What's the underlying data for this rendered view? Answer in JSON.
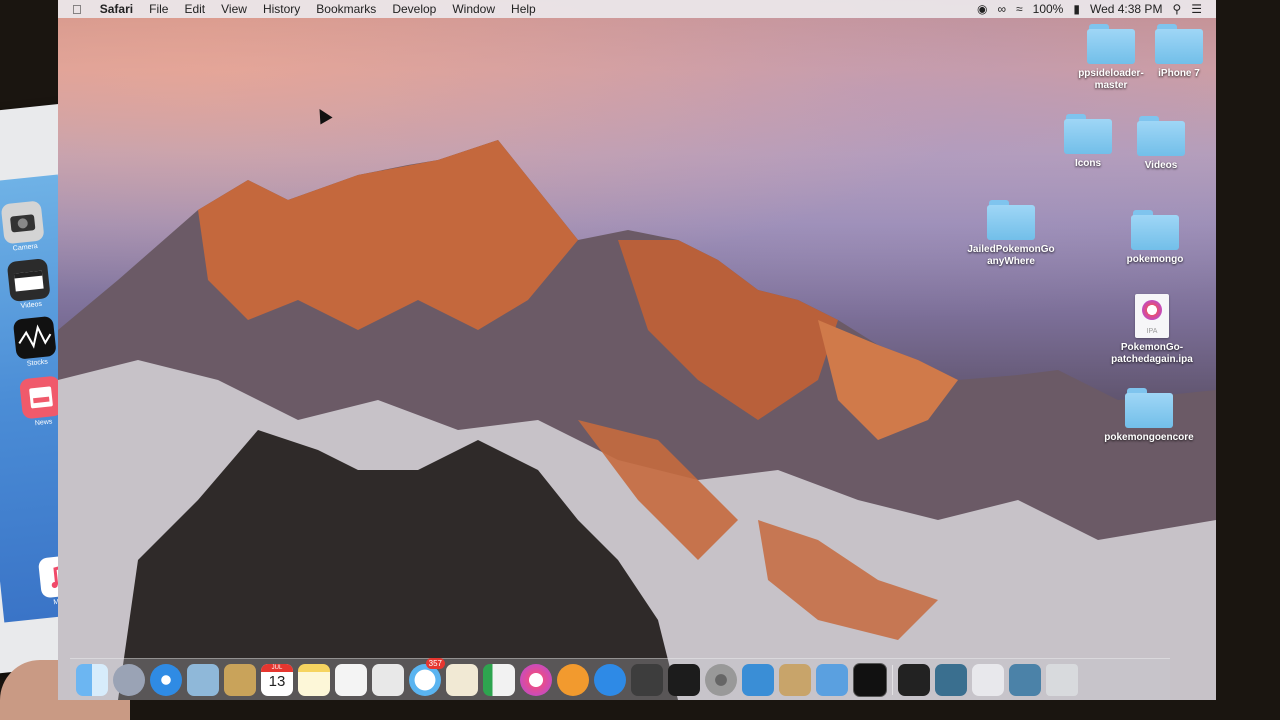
{
  "menubar": {
    "app_name": "Safari",
    "items": [
      "File",
      "Edit",
      "View",
      "History",
      "Bookmarks",
      "Develop",
      "Window",
      "Help"
    ],
    "battery": "100%",
    "clock": "Wed 4:38 PM"
  },
  "desktop_icons": [
    {
      "label": "ppsideloader-master",
      "type": "folder"
    },
    {
      "label": "iPhone 7",
      "type": "folder"
    },
    {
      "label": "Icons",
      "type": "folder"
    },
    {
      "label": "Videos",
      "type": "folder"
    },
    {
      "label": "JailedPokemonGoanyWhere",
      "type": "folder"
    },
    {
      "label": "pokemongo",
      "type": "folder"
    },
    {
      "label": "PokemonGo-patchedagain.ipa",
      "type": "ipa",
      "badge_text": "IPA"
    },
    {
      "label": "pokemongoencore",
      "type": "folder"
    }
  ],
  "dock": {
    "items": [
      "finder-icon",
      "launchpad-icon",
      "safari-icon",
      "preview-icon",
      "contacts-icon",
      "calendar-icon",
      "notes-icon",
      "reminders-icon",
      "photos-icon",
      "messages-icon",
      "textedit-icon",
      "numbers-icon",
      "itunes-icon",
      "ibooks-icon",
      "app-store-icon",
      "photo-booth-icon",
      "final-cut-icon",
      "system-preferences-icon",
      "xcode-icon",
      "keychain-icon",
      "xcode-instruments-icon",
      "terminal-icon",
      "document-icon",
      "screen-share-icon",
      "preview-doc-icon",
      "screen-share-2-icon",
      "trash-icon"
    ],
    "calendar_month": "JUL",
    "calendar_day": "13",
    "messages_badge": "357"
  },
  "phone": {
    "apps": [
      {
        "name": "camera-app-icon",
        "label": "Camera"
      },
      {
        "name": "clips-app-icon",
        "label": "Videos"
      },
      {
        "name": "stocks-app-icon",
        "label": "Stocks"
      },
      {
        "name": "news-app-icon",
        "label": "News"
      },
      {
        "name": "music-app-icon",
        "label": "Music"
      }
    ]
  },
  "colors": {
    "folder_blue": "#7fc4ee",
    "menubar_bg": "#ece8ec",
    "badge_red": "#e6362f"
  }
}
